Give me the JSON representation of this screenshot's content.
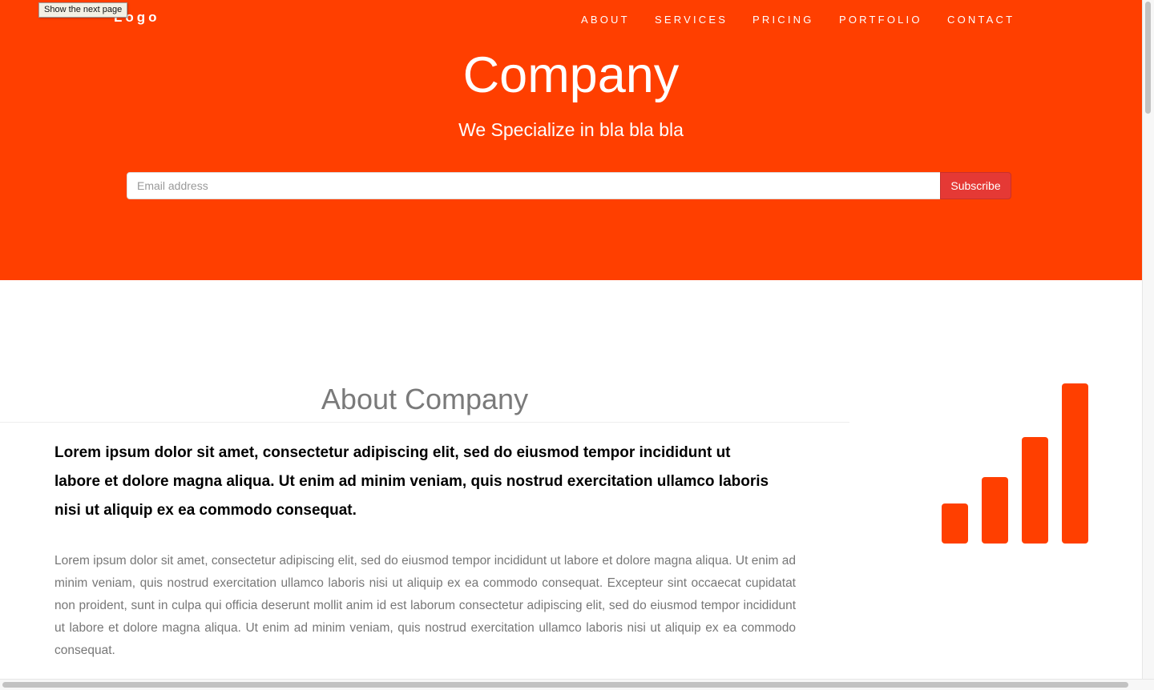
{
  "tooltip": "Show the next page",
  "brand": {
    "logo": "Logo"
  },
  "nav": {
    "items": [
      "ABOUT",
      "SERVICES",
      "PRICING",
      "PORTFOLIO",
      "CONTACT"
    ]
  },
  "hero": {
    "title": "Company",
    "subtitle": "We Specialize in bla bla bla",
    "email_placeholder": "Email address",
    "subscribe_label": "Subscribe"
  },
  "about": {
    "title": "About Company",
    "lead": "Lorem ipsum dolor sit amet, consectetur adipiscing elit, sed do eiusmod tempor incididunt ut labore et dolore magna aliqua. Ut enim ad minim veniam, quis nostrud exercitation ullamco laboris nisi ut aliquip ex ea commodo consequat.",
    "body": "Lorem ipsum dolor sit amet, consectetur adipiscing elit, sed do eiusmod tempor incididunt ut labore et dolore magna aliqua. Ut enim ad minim veniam, quis nostrud exercitation ullamco laboris nisi ut aliquip ex ea commodo consequat. Excepteur sint occaecat cupidatat non proident, sunt in culpa qui officia deserunt mollit anim id est laborum consectetur adipiscing elit, sed do eiusmod tempor incididunt ut labore et dolore magna aliqua. Ut enim ad minim veniam, quis nostrud exercitation ullamco laboris nisi ut aliquip ex ea commodo consequat.",
    "icon": "signal-icon"
  },
  "colors": {
    "accent": "#ff3f00",
    "subscribe": "#e53935",
    "heading_gray": "#7a7a7a",
    "body_gray": "#777777"
  }
}
